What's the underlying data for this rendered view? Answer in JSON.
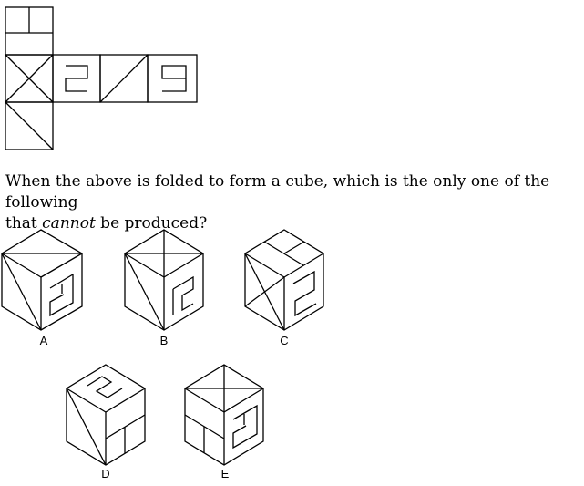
{
  "question": {
    "line1": "When the above is folded to form a cube, which is the only one of the following",
    "line2_before": "that ",
    "line2_italic": "cannot",
    "line2_after": " be produced?"
  },
  "net": {
    "faces": [
      {
        "id": "top-flap",
        "pattern": "horizontal-line-with-half-vertical"
      },
      {
        "id": "left",
        "pattern": "both-diagonals"
      },
      {
        "id": "center-left",
        "pattern": "digit-2"
      },
      {
        "id": "center-right",
        "pattern": "single-diagonal"
      },
      {
        "id": "right",
        "pattern": "digit-9"
      },
      {
        "id": "bottom-flap",
        "pattern": "single-diagonal"
      }
    ]
  },
  "options": [
    {
      "label": "A"
    },
    {
      "label": "B"
    },
    {
      "label": "C"
    },
    {
      "label": "D"
    },
    {
      "label": "E"
    }
  ]
}
